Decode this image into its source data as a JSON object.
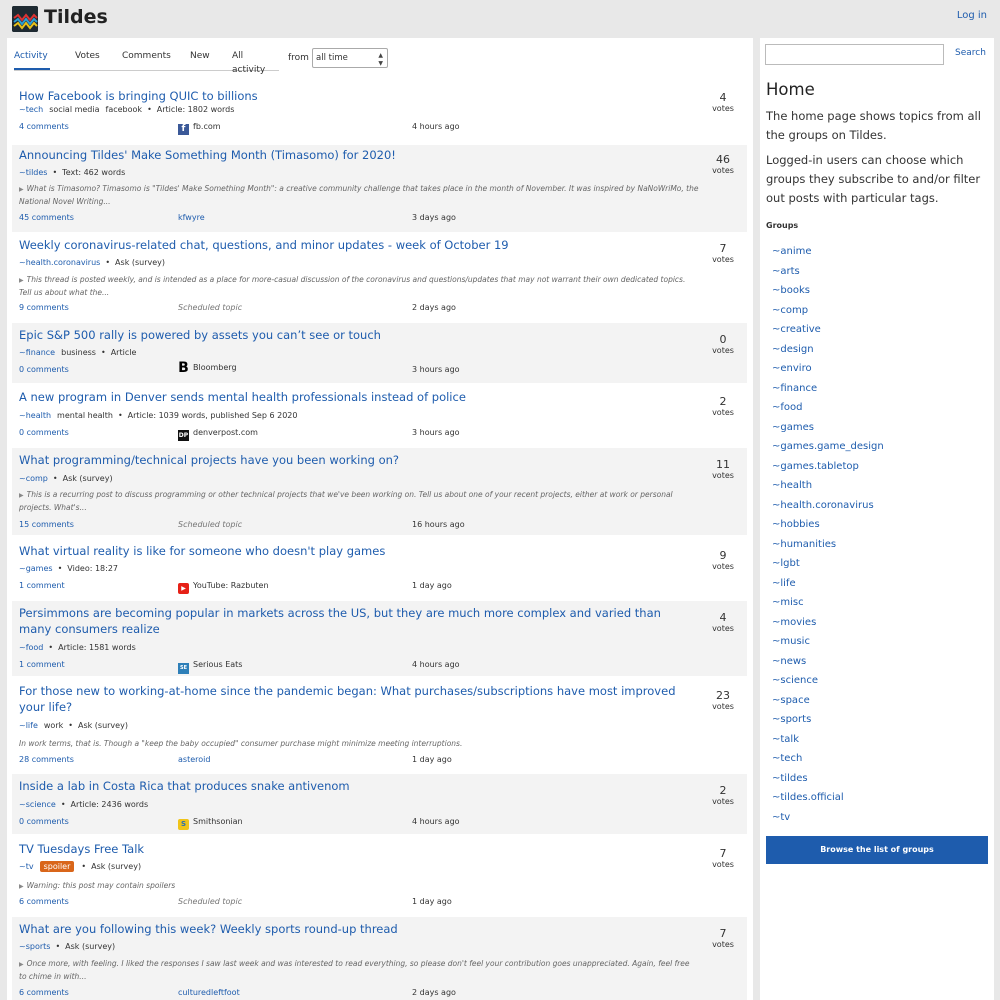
{
  "header": {
    "site_name": "Tildes",
    "login_label": "Log in"
  },
  "tabs": [
    {
      "label": "Activity"
    },
    {
      "label": "Votes"
    },
    {
      "label": "Comments"
    },
    {
      "label": "New"
    },
    {
      "label": "All activity"
    }
  ],
  "filter": {
    "from_label": "from",
    "period_value": "all time"
  },
  "topics": [
    {
      "title": "How Facebook is bringing QUIC to billions",
      "group": "~tech",
      "tags": [
        "social media",
        "facebook"
      ],
      "info": "Article: 1802 words",
      "comments": "4 comments",
      "source": "fb.com",
      "source_icon": "f",
      "time": "4 hours ago",
      "votes": "4",
      "votes_label": "votes"
    },
    {
      "title": "Announcing Tildes' Make Something Month (Timasomo) for 2020!",
      "group": "~tildes",
      "info": "Text: 462 words",
      "excerpt": "What is Timasomo? Timasomo is \"Tildes' Make Something Month\": a creative community challenge that takes place in the month of November. It was inspired by NaNoWriMo, the National Novel Writing...",
      "comments": "45 comments",
      "source": "kfwyre",
      "time": "3 days ago",
      "votes": "46",
      "votes_label": "votes"
    },
    {
      "title": "Weekly coronavirus-related chat, questions, and minor updates - week of October 19",
      "group": "~health.coronavirus",
      "info": "Ask (survey)",
      "excerpt": "This thread is posted weekly, and is intended as a place for more-casual discussion of the coronavirus and questions/updates that may not warrant their own dedicated topics. Tell us about what the...",
      "comments": "9 comments",
      "source": "Scheduled topic",
      "time": "2 days ago",
      "votes": "7",
      "votes_label": "votes"
    },
    {
      "title": "Epic S&P 500 rally is powered by assets you can’t see or touch",
      "group": "~finance",
      "tags": [
        "business"
      ],
      "info": "Article",
      "comments": "0 comments",
      "source": "Bloomberg",
      "source_icon": "B",
      "time": "3 hours ago",
      "votes": "0",
      "votes_label": "votes"
    },
    {
      "title": "A new program in Denver sends mental health professionals instead of police",
      "group": "~health",
      "tags": [
        "mental health"
      ],
      "info": "Article: 1039 words, published Sep 6 2020",
      "comments": "0 comments",
      "source": "denverpost.com",
      "source_icon": "DP",
      "time": "3 hours ago",
      "votes": "2",
      "votes_label": "votes"
    },
    {
      "title": "What programming/technical projects have you been working on?",
      "group": "~comp",
      "info": "Ask (survey)",
      "excerpt": "This is a recurring post to discuss programming or other technical projects that we've been working on. Tell us about one of your recent projects, either at work or personal projects. What's...",
      "comments": "15 comments",
      "source": "Scheduled topic",
      "time": "16 hours ago",
      "votes": "11",
      "votes_label": "votes"
    },
    {
      "title": "What virtual reality is like for someone who doesn't play games",
      "group": "~games",
      "info": "Video: 18:27",
      "comments": "1 comment",
      "source": "YouTube: Razbuten",
      "source_icon": "▶",
      "time": "1 day ago",
      "votes": "9",
      "votes_label": "votes"
    },
    {
      "title": "Persimmons are becoming popular in markets across the US, but they are much more complex and varied than many consumers realize",
      "group": "~food",
      "info": "Article: 1581 words",
      "comments": "1 comment",
      "source": "Serious Eats",
      "source_icon": "SE",
      "time": "4 hours ago",
      "votes": "4",
      "votes_label": "votes"
    },
    {
      "title": "For those new to working-at-home since the pandemic began: What purchases/subscriptions have most improved your life?",
      "group": "~life",
      "tags": [
        "work"
      ],
      "info": "Ask (survey)",
      "excerpt": "In work terms, that is. Though a \"keep the baby occupied\" consumer purchase might minimize meeting interruptions.",
      "comments": "28 comments",
      "source": "asteroid",
      "time": "1 day ago",
      "votes": "23",
      "votes_label": "votes"
    },
    {
      "title": "Inside a lab in Costa Rica that produces snake antivenom",
      "group": "~science",
      "info": "Article: 2436 words",
      "comments": "0 comments",
      "source": "Smithsonian",
      "source_icon": "S",
      "time": "4 hours ago",
      "votes": "2",
      "votes_label": "votes"
    },
    {
      "title": "TV Tuesdays Free Talk",
      "group": "~tv",
      "spoiler": "spoiler",
      "info": "Ask (survey)",
      "excerpt": "Warning: this post may contain spoilers",
      "comments": "6 comments",
      "source": "Scheduled topic",
      "time": "1 day ago",
      "votes": "7",
      "votes_label": "votes"
    },
    {
      "title": "What are you following this week? Weekly sports round-up thread",
      "group": "~sports",
      "info": "Ask (survey)",
      "excerpt": "Once more, with feeling. I liked the responses I saw last week and was interested to read everything, so please don't feel your contribution goes unappreciated. Again, feel free to chime in with...",
      "comments": "6 comments",
      "source": "culturedleftfoot",
      "time": "2 days ago",
      "votes": "7",
      "votes_label": "votes"
    }
  ],
  "sidebar": {
    "search_label": "Search",
    "title": "Home",
    "text1": "The home page shows topics from all the groups on Tildes.",
    "text2": "Logged-in users can choose which groups they subscribe to and/or filter out posts with particular tags.",
    "groups_heading": "Groups",
    "groups": [
      "~anime",
      "~arts",
      "~books",
      "~comp",
      "~creative",
      "~design",
      "~enviro",
      "~finance",
      "~food",
      "~games",
      "~games.game_design",
      "~games.tabletop",
      "~health",
      "~health.coronavirus",
      "~hobbies",
      "~humanities",
      "~lgbt",
      "~life",
      "~misc",
      "~movies",
      "~music",
      "~news",
      "~science",
      "~space",
      "~sports",
      "~talk",
      "~tech",
      "~tildes",
      "~tildes.official",
      "~tv"
    ],
    "browse_label": "Browse the list of groups"
  },
  "colors": {
    "link": "#1e5cad",
    "spoiler": "#d9661a",
    "button": "#1e5cad"
  }
}
